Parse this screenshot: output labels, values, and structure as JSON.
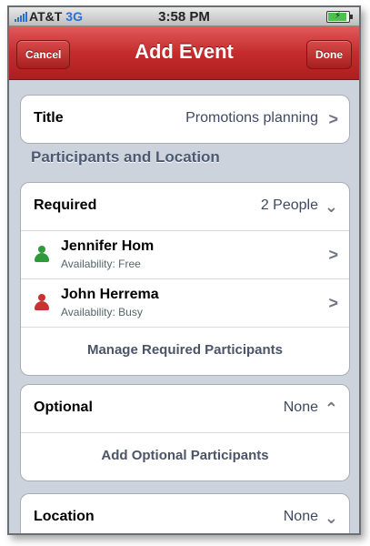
{
  "status_bar": {
    "carrier": "AT&T",
    "network": "3G",
    "time": "3:58 PM"
  },
  "nav": {
    "cancel": "Cancel",
    "title": "Add Event",
    "done": "Done"
  },
  "title_row": {
    "label": "Title",
    "value": "Promotions planning"
  },
  "section_header": "Participants and Location",
  "required": {
    "label": "Required",
    "value": "2 People",
    "participants": [
      {
        "name": "Jennifer Hom",
        "availability": "Availability: Free",
        "status_color": "#2e9a3c"
      },
      {
        "name": "John Herrema",
        "availability": "Availability: Busy",
        "status_color": "#c73232"
      }
    ],
    "manage": "Manage Required Participants"
  },
  "optional": {
    "label": "Optional",
    "value": "None",
    "add": "Add Optional Participants"
  },
  "location": {
    "label": "Location",
    "value": "None"
  },
  "colors": {
    "nav_red": "#c52c2c",
    "background": "#ccd3dd",
    "section_text": "#4c5973"
  }
}
